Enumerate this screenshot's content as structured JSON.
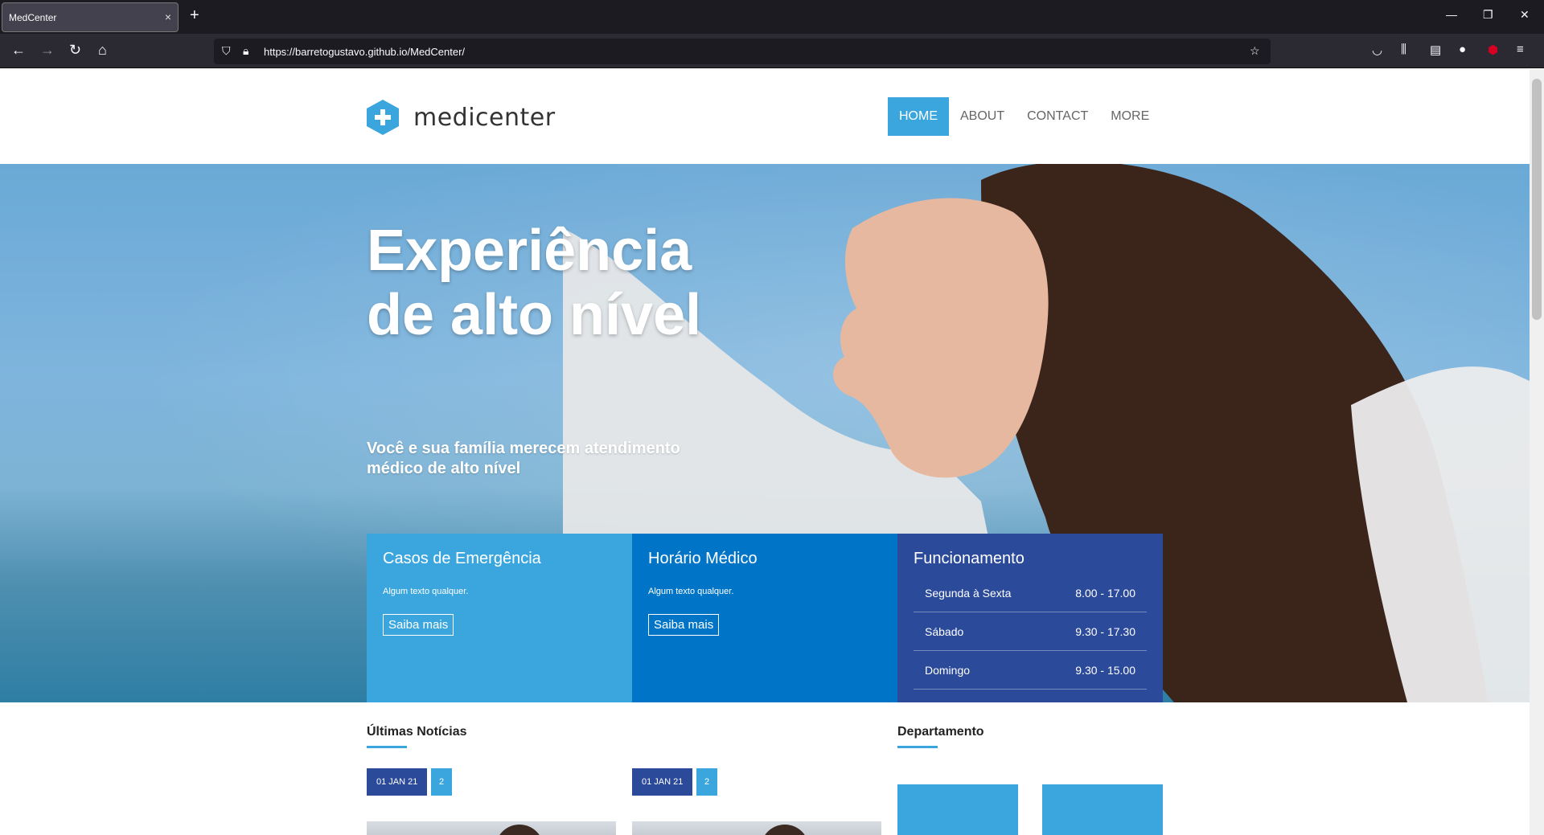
{
  "browser": {
    "tab_title": "MedCenter",
    "tab_close": "×",
    "new_tab": "+",
    "url": "https://barretogustavo.github.io/MedCenter/"
  },
  "site": {
    "logo_text": "medicenter",
    "menu": [
      {
        "label": "HOME",
        "active": true
      },
      {
        "label": "ABOUT",
        "active": false
      },
      {
        "label": "CONTACT",
        "active": false
      },
      {
        "label": "MORE",
        "active": false
      }
    ]
  },
  "hero": {
    "title": "Experiência de alto nível",
    "subtitle": "Você e sua família merecem atendimento médico de alto nível"
  },
  "boxes": {
    "emergency": {
      "title": "Casos de Emergência",
      "text": "Algum texto qualquer.",
      "button": "Saiba mais"
    },
    "schedule": {
      "title": "Horário Médico",
      "text": "Algum texto qualquer.",
      "button": "Saiba mais"
    },
    "hours": {
      "title": "Funcionamento",
      "rows": [
        {
          "day": "Segunda à Sexta",
          "time": "8.00 - 17.00"
        },
        {
          "day": "Sábado",
          "time": "9.30 - 17.30"
        },
        {
          "day": "Domingo",
          "time": "9.30 - 15.00"
        }
      ]
    }
  },
  "news": {
    "title": "Últimas Notícias",
    "items": [
      {
        "date": "01 JAN 21",
        "count": "2"
      },
      {
        "date": "01 JAN 21",
        "count": "2"
      }
    ]
  },
  "department": {
    "title": "Departamento"
  },
  "colors": {
    "accent": "#3ba6de",
    "dark_blue": "#2b4a9a",
    "mid_blue": "#0074c7"
  }
}
